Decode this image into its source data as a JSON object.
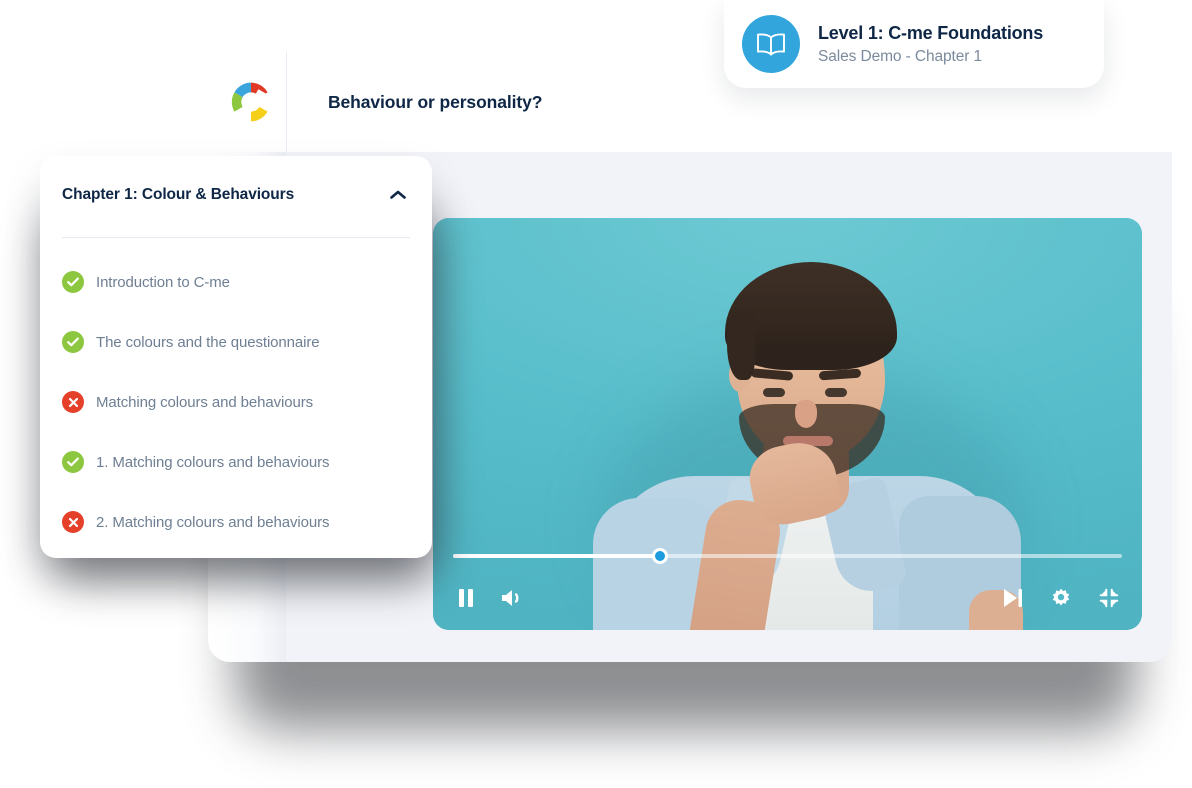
{
  "course_badge": {
    "title": "Level 1: C-me Foundations",
    "subtitle": "Sales Demo - Chapter 1",
    "icon": "open-book-icon",
    "icon_bg_color": "#32a5dd"
  },
  "app": {
    "logo": "c-me-logo",
    "logo_colors": [
      "#e03a27",
      "#3aa5dc",
      "#8dc63f",
      "#f5cf18"
    ],
    "title": "Behaviour or personality?"
  },
  "chapter_panel": {
    "title": "Chapter 1: Colour & Behaviours",
    "collapse_icon": "chevron-up-icon",
    "lessons": [
      {
        "label": "Introduction to C-me",
        "status": "complete",
        "icon": "check-circle-icon"
      },
      {
        "label": "The colours and the questionnaire",
        "status": "complete",
        "icon": "check-circle-icon"
      },
      {
        "label": "Matching colours and behaviours",
        "status": "incomplete",
        "icon": "x-circle-icon"
      },
      {
        "label": "1. Matching colours and behaviours",
        "status": "complete",
        "icon": "check-circle-icon"
      },
      {
        "label": "2. Matching colours and behaviours",
        "status": "incomplete",
        "icon": "x-circle-icon"
      }
    ],
    "status_colors": {
      "complete": "#8dc63f",
      "incomplete": "#e5402a"
    }
  },
  "video": {
    "background_color": "#5dc1cd",
    "progress_percent": 31,
    "thumb_color": "#1e9ce0",
    "controls": {
      "left": [
        {
          "name": "pause-button",
          "icon": "pause-icon"
        },
        {
          "name": "volume-button",
          "icon": "volume-icon"
        }
      ],
      "right": [
        {
          "name": "skip-forward-button",
          "icon": "skip-forward-icon"
        },
        {
          "name": "settings-button",
          "icon": "gear-icon"
        },
        {
          "name": "exit-fullscreen-button",
          "icon": "compress-icon"
        }
      ]
    }
  }
}
